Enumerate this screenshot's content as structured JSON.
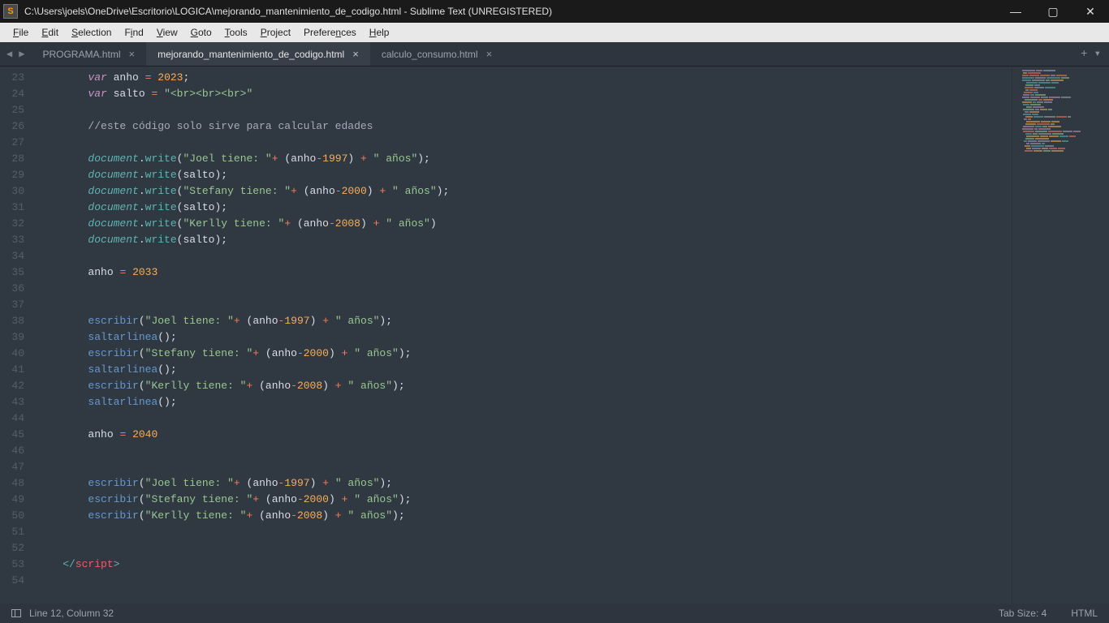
{
  "window": {
    "title": "C:\\Users\\joels\\OneDrive\\Escritorio\\LOGICA\\mejorando_mantenimiento_de_codigo.html - Sublime Text (UNREGISTERED)"
  },
  "menubar": [
    {
      "label": "File",
      "mn": "F"
    },
    {
      "label": "Edit",
      "mn": "E"
    },
    {
      "label": "Selection",
      "mn": "S"
    },
    {
      "label": "Find",
      "mn": "i"
    },
    {
      "label": "View",
      "mn": "V"
    },
    {
      "label": "Goto",
      "mn": "G"
    },
    {
      "label": "Tools",
      "mn": "T"
    },
    {
      "label": "Project",
      "mn": "P"
    },
    {
      "label": "Preferences",
      "mn": "n"
    },
    {
      "label": "Help",
      "mn": "H"
    }
  ],
  "tabs": [
    {
      "label": "PROGRAMA.html",
      "active": false
    },
    {
      "label": "mejorando_mantenimiento_de_codigo.html",
      "active": true
    },
    {
      "label": "calculo_consumo.html",
      "active": false
    }
  ],
  "gutter": {
    "start": 23,
    "end": 54
  },
  "code": {
    "line23": {
      "kw": "var",
      "name": "anho",
      "eq": "=",
      "year": "2023",
      "semi": ";"
    },
    "line24": {
      "kw": "var",
      "name": "salto",
      "eq": "=",
      "str": "\"<br><br><br>\""
    },
    "line26": {
      "cmt": "//este código solo sirve para calcular edades"
    },
    "dw": {
      "obj": "document",
      "dot": ".",
      "fn": "write"
    },
    "joel": {
      "str1": "\"Joel tiene: \"",
      "plus": "+",
      "lp": "(",
      "v": "anho",
      "minus": "-",
      "y": "1997",
      "rp": ")",
      "plus2": "+",
      "str2": "\" años\"",
      "end": ");"
    },
    "stefany": {
      "str1": "\"Stefany tiene: \"",
      "y": "2000",
      "str2": "\" años\"",
      "end": ");"
    },
    "kerlly": {
      "str1": "\"Kerlly tiene: \"",
      "y": "2008",
      "str2": "\" años\"",
      "end": ")"
    },
    "salto": {
      "arg": "salto",
      "end": ");"
    },
    "esc": {
      "fn": "escribir"
    },
    "sal": {
      "fn": "saltarlinea",
      "call": "();"
    },
    "a35": {
      "v": "anho",
      "eq": "=",
      "y": "2033"
    },
    "a45": {
      "v": "anho",
      "eq": "=",
      "y": "2040"
    },
    "closetag": {
      "open": "</",
      "tag": "script",
      "close": ">"
    }
  },
  "status": {
    "pos": "Line 12, Column 32",
    "tabsize": "Tab Size: 4",
    "syntax": "HTML"
  }
}
